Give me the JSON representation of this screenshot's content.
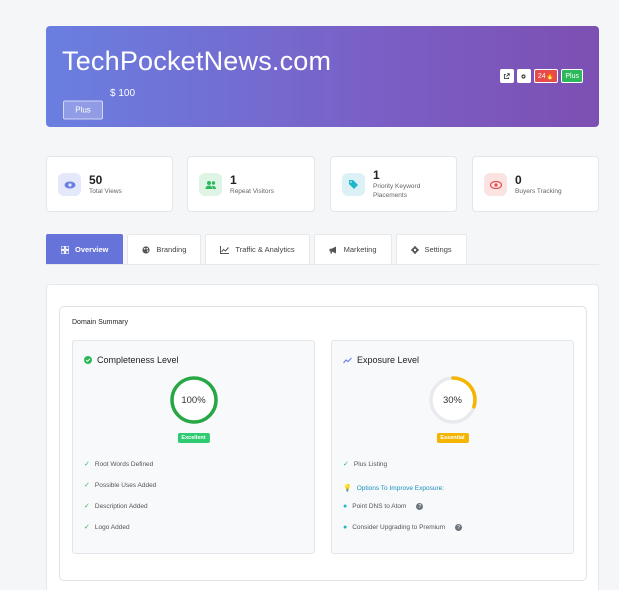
{
  "header": {
    "domain": "TechPocketNews.com",
    "plan_button": "Plus",
    "price": "$ 100",
    "tools": {
      "external_icon": "external-link-icon",
      "settings_icon": "gear-icon",
      "red_badge": "24🔥",
      "green_badge": "Plus"
    }
  },
  "stats": [
    {
      "value": "50",
      "label": "Total Views",
      "icon": "eye-icon",
      "color": "#6a7fe0"
    },
    {
      "value": "1",
      "label": "Repeat Visitors",
      "icon": "users-icon",
      "color": "#2eb85c"
    },
    {
      "value": "1",
      "label": "Priority Keyword Placements",
      "icon": "tags-icon",
      "color": "#1fb6c9"
    },
    {
      "value": "0",
      "label": "Buyers Tracking",
      "icon": "eye-icon",
      "color": "#e54b4b"
    }
  ],
  "tabs": [
    {
      "label": "Overview",
      "icon": "dashboard-icon"
    },
    {
      "label": "Branding",
      "icon": "palette-icon"
    },
    {
      "label": "Traffic & Analytics",
      "icon": "chart-line-icon"
    },
    {
      "label": "Marketing",
      "icon": "megaphone-icon"
    },
    {
      "label": "Settings",
      "icon": "gear-icon"
    }
  ],
  "summary": {
    "title": "Domain Summary",
    "completeness": {
      "title": "Completeness Level",
      "percent_text": "100%",
      "percent": 100,
      "badge": "Excellent",
      "items": [
        "Root Words Defined",
        "Possible Uses Added",
        "Description Added",
        "Logo Added"
      ]
    },
    "exposure": {
      "title": "Exposure Level",
      "percent_text": "30%",
      "percent": 30,
      "badge": "Essential",
      "items": [
        "Plus Listing"
      ],
      "options_title": "Options To Improve Exposure:",
      "options": [
        "Point DNS to Atom",
        "Consider Upgrading to Premium"
      ]
    }
  }
}
